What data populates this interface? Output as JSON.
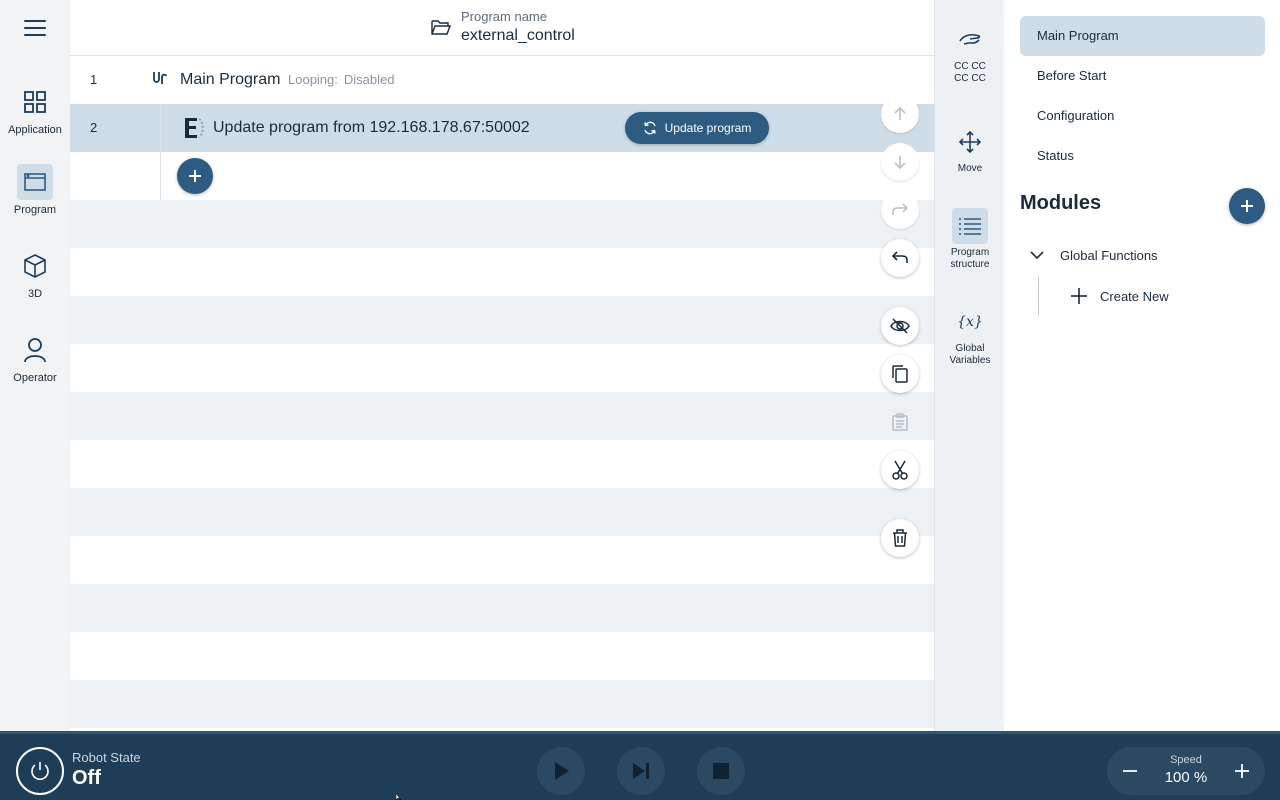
{
  "nav": {
    "items": [
      {
        "label": "Application",
        "icon": "grid-icon"
      },
      {
        "label": "Program",
        "icon": "program-window-icon"
      },
      {
        "label": "3D",
        "icon": "cube-icon"
      },
      {
        "label": "Operator",
        "icon": "person-icon"
      }
    ]
  },
  "header": {
    "program_name_label": "Program name",
    "program_name": "external_control"
  },
  "program": {
    "rows": [
      {
        "number": "1",
        "title": "Main Program",
        "looping_label": "Looping:",
        "looping_value": "Disabled"
      },
      {
        "number": "2",
        "title": "Update program from 192.168.178.67:50002",
        "button_label": "Update program"
      }
    ]
  },
  "rail": {
    "items": [
      {
        "label": "CC CC\nCC CC",
        "icon": "hand-icon"
      },
      {
        "label": "Move",
        "icon": "move-arrows-icon"
      },
      {
        "label": "Program structure",
        "icon": "list-icon"
      },
      {
        "label": "Global Variables",
        "icon": "variable-icon",
        "glyph": "{x}"
      }
    ]
  },
  "right_panel": {
    "items": [
      "Main Program",
      "Before Start",
      "Configuration",
      "Status"
    ],
    "modules_title": "Modules",
    "global_functions": "Global Functions",
    "create_new": "Create New"
  },
  "footer": {
    "robot_state_label": "Robot State",
    "robot_state_value": "Off",
    "speed_label": "Speed",
    "speed_value": "100 %"
  },
  "colors": {
    "accent": "#2d5b82",
    "selected": "#cfdde8",
    "footer": "#1e3d56"
  }
}
